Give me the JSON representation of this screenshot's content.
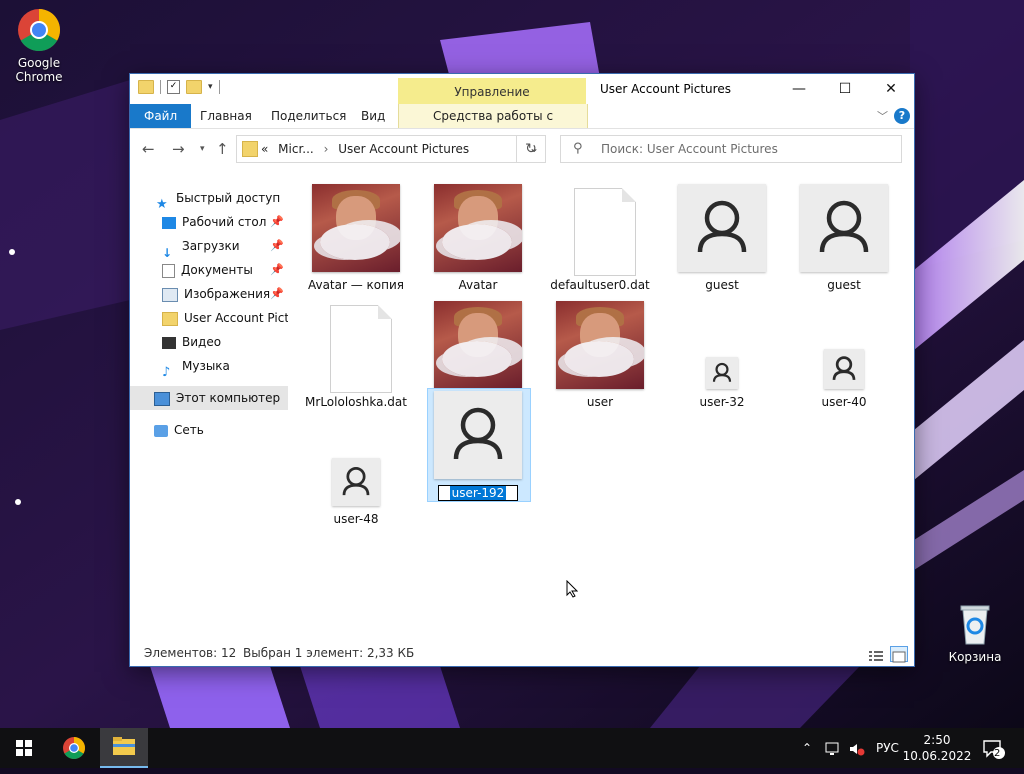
{
  "desktop": {
    "chrome_label_line1": "Google",
    "chrome_label_line2": "Chrome",
    "recycle_label": "Корзина"
  },
  "window": {
    "title": "User Account Pictures",
    "manage_label": "Управление",
    "tabs": {
      "file": "Файл",
      "home": "Главная",
      "share": "Поделиться",
      "view": "Вид",
      "picture_tools": "Средства работы с рисунками"
    },
    "address": {
      "prefix": "«",
      "segment1": "Micr...",
      "segment2": "User Account Pictures"
    },
    "search_placeholder": "Поиск: User Account Pictures"
  },
  "nav_pane": {
    "items": [
      {
        "label": "Быстрый доступ",
        "icon": "star-icon",
        "pinned": false
      },
      {
        "label": "Рабочий стол",
        "icon": "desktop-icon",
        "pinned": true
      },
      {
        "label": "Загрузки",
        "icon": "download-icon",
        "pinned": true
      },
      {
        "label": "Документы",
        "icon": "document-icon",
        "pinned": true
      },
      {
        "label": "Изображения",
        "icon": "pictures-icon",
        "pinned": true
      },
      {
        "label": "User Account Pictur",
        "icon": "folder-icon",
        "pinned": false
      },
      {
        "label": "Видео",
        "icon": "video-icon",
        "pinned": false
      },
      {
        "label": "Музыка",
        "icon": "music-icon",
        "pinned": false
      },
      {
        "label": "Этот компьютер",
        "icon": "computer-icon",
        "pinned": false
      },
      {
        "label": "Сеть",
        "icon": "network-icon",
        "pinned": false
      }
    ]
  },
  "files": [
    {
      "name": "Avatar — копия",
      "type": "avatar-image"
    },
    {
      "name": "Avatar",
      "type": "avatar-image"
    },
    {
      "name": "defaultuser0.dat",
      "type": "dat-file"
    },
    {
      "name": "guest",
      "type": "user-image"
    },
    {
      "name": "guest",
      "type": "user-image"
    },
    {
      "name": "MrLololoshka.dat",
      "type": "dat-file"
    },
    {
      "name": "user",
      "type": "avatar-image"
    },
    {
      "name": "user",
      "type": "avatar-image"
    },
    {
      "name": "user-32",
      "type": "user-image"
    },
    {
      "name": "user-40",
      "type": "user-image"
    },
    {
      "name": "user-48",
      "type": "user-image"
    },
    {
      "name": "user-192",
      "type": "user-image",
      "selected": true,
      "renaming": true
    }
  ],
  "status": {
    "count": "Элементов: 12",
    "selection": "Выбран 1 элемент: 2,33 КБ"
  },
  "taskbar": {
    "language": "РУС",
    "time": "2:50",
    "date": "10.06.2022",
    "notifications": "2"
  },
  "colors": {
    "accent": "#1979ca",
    "manage_band": "#f5ec8d",
    "selection": "#cce8ff"
  }
}
